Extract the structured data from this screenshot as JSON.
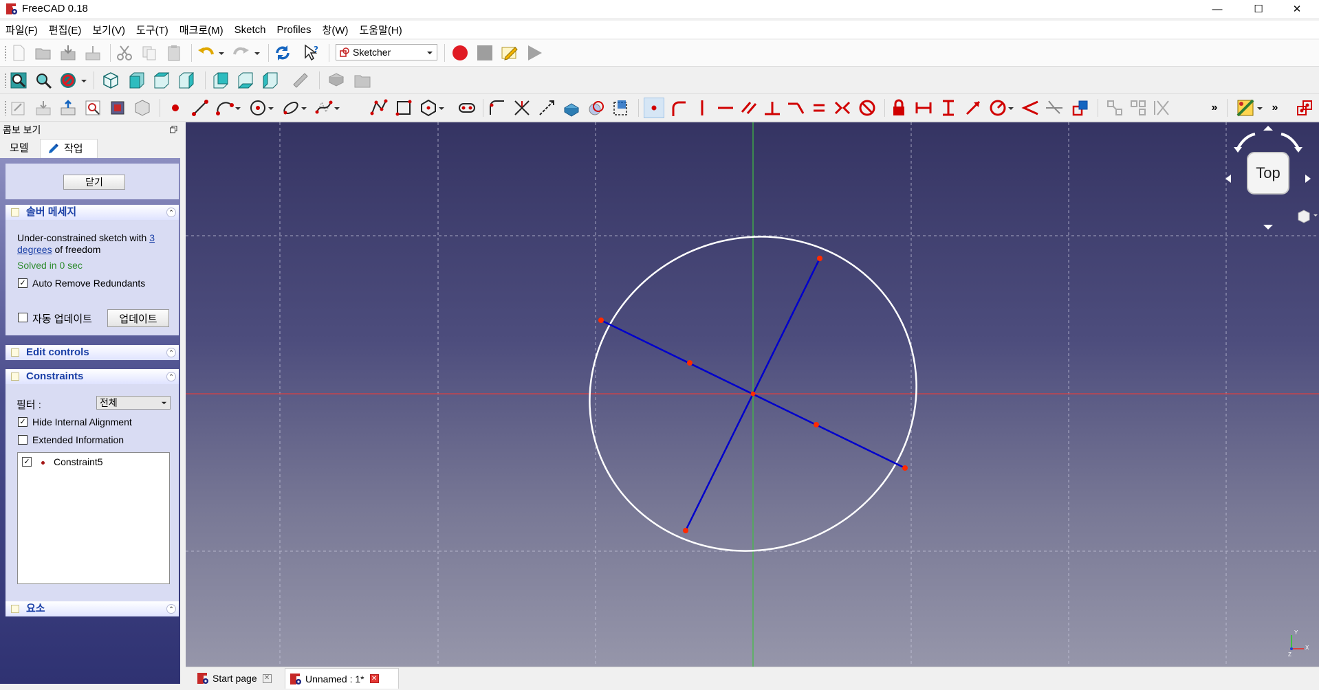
{
  "window": {
    "title": "FreeCAD 0.18",
    "minimize_glyph": "—",
    "maximize_glyph": "☐",
    "close_glyph": "✕"
  },
  "menu": [
    "파일(F)",
    "편집(E)",
    "보기(V)",
    "도구(T)",
    "매크로(M)",
    "Sketch",
    "Profiles",
    "창(W)",
    "도움말(H)"
  ],
  "toolbar": {
    "workbench": "Sketcher",
    "overflow_glyph": "»"
  },
  "combo_view": {
    "title": "콤보 보기",
    "tabs": {
      "model": "모델",
      "task": "작업"
    }
  },
  "task_panel": {
    "close_button": "닫기",
    "solver": {
      "title": "솔버 메세지",
      "message_prefix": "Under-constrained sketch with ",
      "dof_link": "3 degrees",
      "message_suffix": " of freedom",
      "dof_line1": "3",
      "dof_line2": "degrees",
      "solved": "Solved in 0 sec",
      "auto_remove": {
        "label": "Auto Remove Redundants",
        "checked": true
      },
      "auto_update": {
        "label": "자동 업데이트",
        "checked": false
      },
      "update_button": "업데이트"
    },
    "edit_controls": {
      "title": "Edit controls"
    },
    "constraints": {
      "title": "Constraints",
      "filter_label": "필터 :",
      "filter_value": "전체",
      "hide_internal": {
        "label": "Hide Internal Alignment",
        "checked": true
      },
      "extended_info": {
        "label": "Extended Information",
        "checked": false
      },
      "items": [
        {
          "label": "Constraint5",
          "checked": true
        }
      ]
    },
    "elements": {
      "title": "요소"
    }
  },
  "viewport": {
    "navcube_face": "Top",
    "axis_labels": {
      "x": "X",
      "y": "Y",
      "z": "Z"
    },
    "colors": {
      "background_top": "#353463",
      "background_bottom": "#9696aa",
      "geometry": "#ffffff",
      "construction": "#0000cc",
      "points": "#ff2a00",
      "x_axis": "#d94040",
      "y_axis": "#40c040"
    }
  },
  "doc_tabs": [
    {
      "label": "Start page",
      "active": false
    },
    {
      "label": "Unnamed : 1*",
      "active": true
    }
  ]
}
